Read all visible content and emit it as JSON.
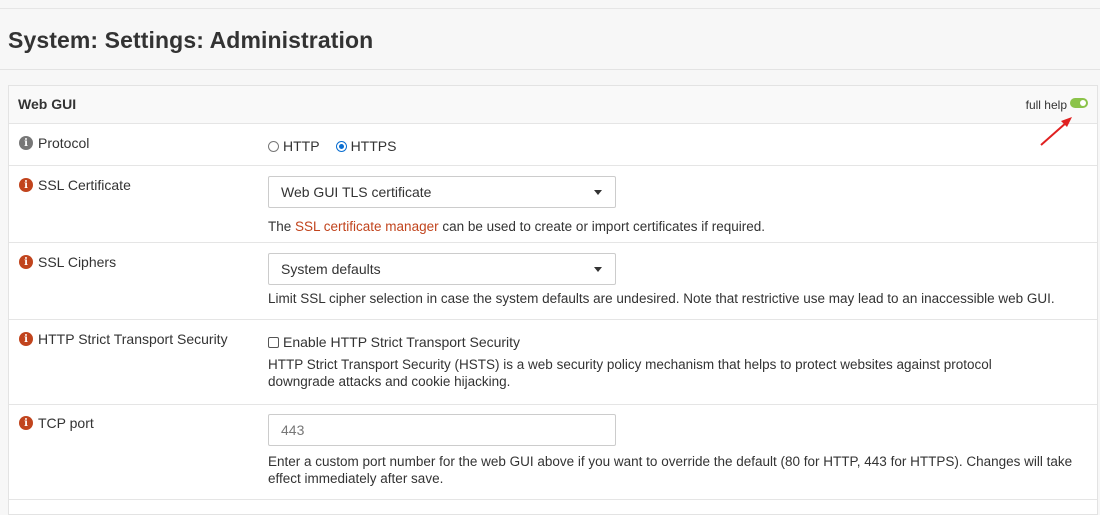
{
  "page": {
    "title": "System: Settings: Administration"
  },
  "panel": {
    "title": "Web GUI",
    "full_help_label": "full help",
    "full_help_enabled": true,
    "toggle_color": "#8bc34a"
  },
  "rows": {
    "protocol": {
      "label": "Protocol",
      "options": [
        "HTTP",
        "HTTPS"
      ],
      "selected": "HTTPS"
    },
    "ssl_certificate": {
      "label": "SSL Certificate",
      "value": "Web GUI TLS certificate",
      "help_prefix": "The ",
      "help_link": "SSL certificate manager",
      "help_suffix": " can be used to create or import certificates if required."
    },
    "ssl_ciphers": {
      "label": "SSL Ciphers",
      "value": "System defaults",
      "help": "Limit SSL cipher selection in case the system defaults are undesired. Note that restrictive use may lead to an inaccessible web GUI."
    },
    "hsts": {
      "label": "HTTP Strict Transport Security",
      "checkbox_label": "Enable HTTP Strict Transport Security",
      "checked": false,
      "help": "HTTP Strict Transport Security (HSTS) is a web security policy mechanism that helps to protect websites against protocol downgrade attacks and cookie hijacking."
    },
    "tcp_port": {
      "label": "TCP port",
      "placeholder": "443",
      "help": "Enter a custom port number for the web GUI above if you want to override the default (80 for HTTP, 443 for HTTPS). Changes will take effect immediately after save."
    }
  },
  "colors": {
    "accent": "#c1441d",
    "radio_selected": "#0a6ed1",
    "annotation_arrow": "#e02020"
  },
  "icons": {
    "info": "info-icon",
    "dropdown": "chevron-down-icon"
  }
}
